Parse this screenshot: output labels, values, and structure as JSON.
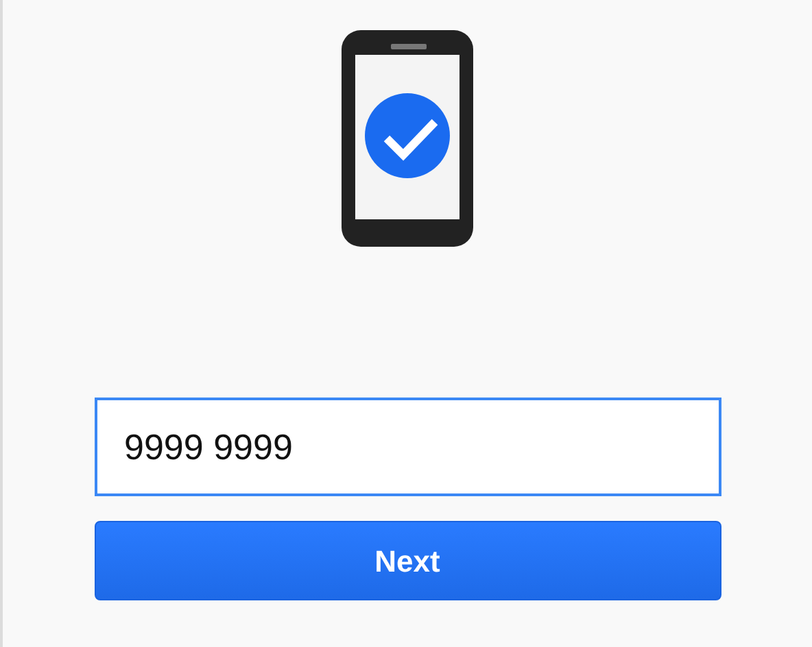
{
  "phone_field": {
    "value": "9999 9999",
    "focused": true
  },
  "next_button": {
    "label": "Next"
  }
}
